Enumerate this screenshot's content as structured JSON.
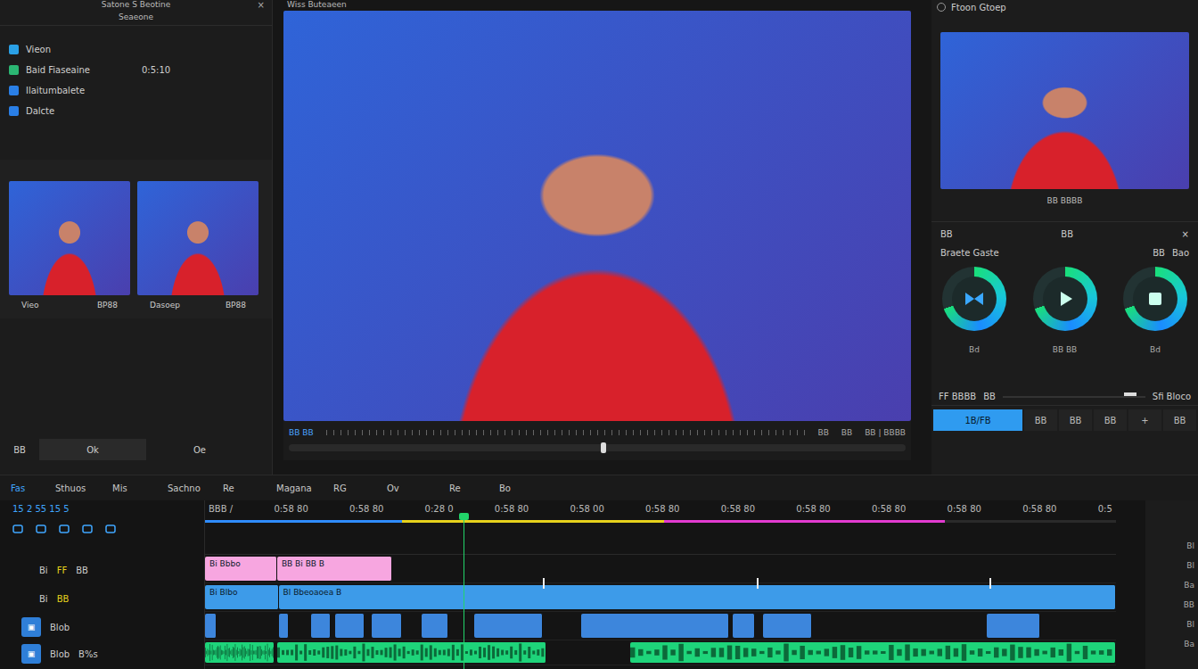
{
  "left_panel": {
    "title": "Satone S Beotine",
    "subtitle": "Seaeone",
    "close": "×",
    "items": [
      {
        "label": "Vieon",
        "value": "",
        "color": "#2aa0e6"
      },
      {
        "label": "Baid Fiaseaine",
        "value": "0:5:10",
        "color": "#2bb673"
      },
      {
        "label": "Ilaitumbalete",
        "value": "",
        "color": "#2a7fe6"
      },
      {
        "label": "Dalcte",
        "value": "",
        "color": "#2a7fe6"
      }
    ],
    "thumbnails": [
      {
        "label": "Vieo",
        "value": "BP88"
      },
      {
        "label": "Dasoep",
        "value": "BP88"
      }
    ],
    "footer": [
      "BB",
      "Ok",
      "Oe"
    ]
  },
  "preview": {
    "title": "Wiss Buteaeen",
    "controls_left": "BB BB",
    "controls_right": [
      "BB",
      "BB",
      "BB | BBBB"
    ],
    "level": 0.51
  },
  "right_panel": {
    "title": "Ftoon Gtoep",
    "caption": "BB BBBB",
    "toolbar": [
      "BB",
      "BB",
      "×"
    ],
    "section": "Braete Gaste",
    "section_right": [
      "BB",
      "Bao"
    ],
    "buttons": [
      {
        "label": "Bd",
        "kind": "bowtie"
      },
      {
        "label": "BB BB",
        "kind": "play"
      },
      {
        "label": "Bd",
        "kind": "stop"
      }
    ],
    "info": {
      "left": "FF BBBB",
      "mid": "BB",
      "right": "Sfi Bloco"
    },
    "tabs": [
      {
        "label": "1B/FB",
        "selected": true
      },
      {
        "label": "BB",
        "selected": false
      },
      {
        "label": "BB",
        "selected": false
      },
      {
        "label": "BB",
        "selected": false
      },
      {
        "label": "+",
        "selected": false
      },
      {
        "label": "BB",
        "selected": false
      }
    ]
  },
  "timeline": {
    "tabs": [
      {
        "label": "Fas",
        "selected": true
      },
      {
        "label": "Sthuos",
        "selected": false
      },
      {
        "label": "Mis",
        "selected": false
      },
      {
        "label": "Sachno",
        "selected": false
      },
      {
        "label": "Re",
        "selected": false
      },
      {
        "label": "Magana",
        "selected": false
      },
      {
        "label": "RG",
        "selected": false
      },
      {
        "label": "Ov",
        "selected": false
      },
      {
        "label": "Re",
        "selected": false
      },
      {
        "label": "Bo",
        "selected": false
      }
    ],
    "tools": "15 2 55 15 5",
    "ruler": [
      "BBB /",
      "0:58 80",
      "0:58 80",
      "0:28 0",
      "0:58 80",
      "0:58 00",
      "0:58 80",
      "0:58 80",
      "0:58 80",
      "0:58 80",
      "0:58 80",
      "0:58 80",
      "0:5"
    ],
    "playhead": 3.4,
    "segments": [
      {
        "start": 0,
        "end": 2.6,
        "color": "#2f8cff"
      },
      {
        "start": 2.6,
        "end": 6.05,
        "color": "#e6d21c"
      },
      {
        "start": 6.05,
        "end": 9.75,
        "color": "#e23bd0"
      }
    ],
    "tracks": [
      {
        "kind": "title",
        "labels": [
          "Bi",
          "FF",
          "BB"
        ],
        "color": "#f7a6e0",
        "markers": [],
        "clips": [
          {
            "start": 0,
            "end": 0.95,
            "label": "Bi Bbbo"
          },
          {
            "start": 0.95,
            "end": 2.47,
            "label": "BB Bi BB B"
          }
        ]
      },
      {
        "kind": "video",
        "labels": [
          "Bi",
          "BB"
        ],
        "color": "#3d9be9",
        "markers": [
          4.45,
          7.27,
          10.33
        ],
        "clips": [
          {
            "start": 0,
            "end": 0.97,
            "label": "Bi Blbo"
          },
          {
            "start": 0.97,
            "end": 12,
            "label": "Bl Bbeoaoea B"
          }
        ]
      },
      {
        "kind": "broll",
        "labels": [
          "Blob"
        ],
        "color": "#3d86dc",
        "markers": [],
        "clips": [
          {
            "start": 0,
            "end": 0.15,
            "label": ""
          },
          {
            "start": 0.97,
            "end": 1.1,
            "label": ""
          },
          {
            "start": 1.4,
            "end": 1.65,
            "label": ""
          },
          {
            "start": 1.72,
            "end": 2.1,
            "label": ""
          },
          {
            "start": 2.2,
            "end": 2.6,
            "label": ""
          },
          {
            "start": 2.85,
            "end": 3.2,
            "label": ""
          },
          {
            "start": 3.55,
            "end": 4.45,
            "label": ""
          },
          {
            "start": 4.95,
            "end": 6.9,
            "label": ""
          },
          {
            "start": 6.95,
            "end": 7.25,
            "label": ""
          },
          {
            "start": 7.35,
            "end": 8.0,
            "label": ""
          },
          {
            "start": 10.3,
            "end": 11.0,
            "label": ""
          }
        ]
      },
      {
        "kind": "audio",
        "labels": [
          "Blob",
          "B%s"
        ],
        "color": "#1ed47a",
        "markers": [],
        "clips": [
          {
            "start": 0,
            "end": 0.92,
            "label": ""
          },
          {
            "start": 0.95,
            "end": 4.5,
            "label": ""
          },
          {
            "start": 5.6,
            "end": 12,
            "label": ""
          }
        ]
      }
    ],
    "side": [
      "Bl",
      "Bl",
      "Ba",
      "BB",
      "Bl",
      "Ba"
    ]
  }
}
